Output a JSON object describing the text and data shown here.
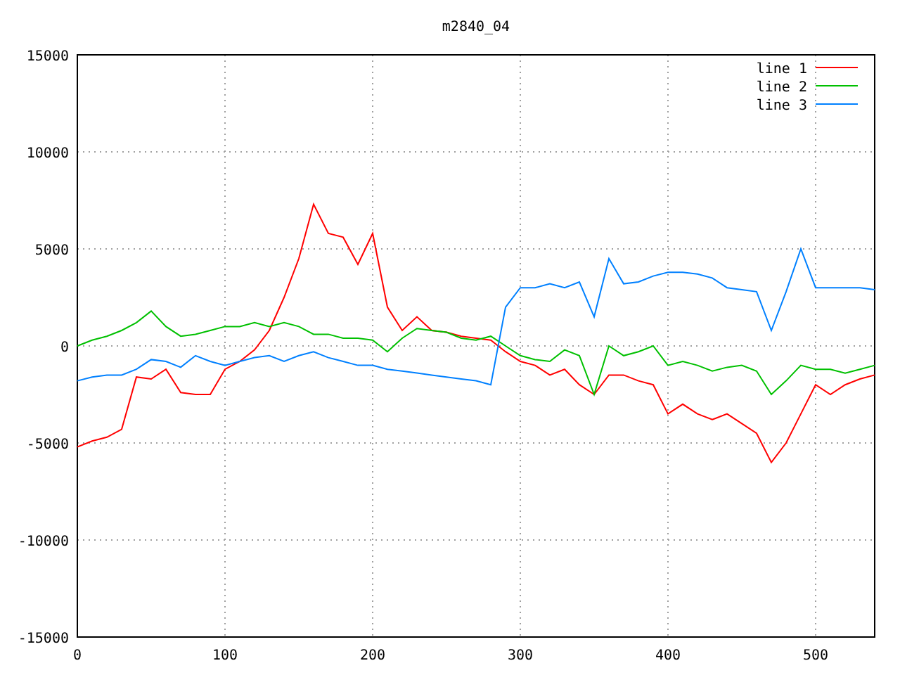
{
  "chart_data": {
    "type": "line",
    "title": "m2840_04",
    "x": [
      0,
      10,
      20,
      30,
      40,
      50,
      60,
      70,
      80,
      90,
      100,
      110,
      120,
      130,
      140,
      150,
      160,
      170,
      180,
      190,
      200,
      210,
      220,
      230,
      240,
      250,
      260,
      270,
      280,
      290,
      300,
      310,
      320,
      330,
      340,
      350,
      360,
      370,
      380,
      390,
      400,
      410,
      420,
      430,
      440,
      450,
      460,
      470,
      480,
      490,
      500,
      510,
      520,
      530,
      540
    ],
    "series": [
      {
        "name": "line 1",
        "color": "#ff0000",
        "values": [
          -5200,
          -4900,
          -4700,
          -4300,
          -1600,
          -1700,
          -1200,
          -2400,
          -2500,
          -2500,
          -1200,
          -800,
          -200,
          800,
          2500,
          4500,
          7300,
          5800,
          5600,
          4200,
          5800,
          2000,
          800,
          1500,
          800,
          700,
          500,
          400,
          300,
          -300,
          -800,
          -1000,
          -1500,
          -1200,
          -2000,
          -2500,
          -1500,
          -1500,
          -1800,
          -2000,
          -3500,
          -3000,
          -3500,
          -3800,
          -3500,
          -4000,
          -4500,
          -6000,
          -5000,
          -3500,
          -2000,
          -2500,
          -2000,
          -1700,
          -1500
        ]
      },
      {
        "name": "line 2",
        "color": "#00c000",
        "values": [
          0,
          300,
          500,
          800,
          1200,
          1800,
          1000,
          500,
          600,
          800,
          1000,
          1000,
          1200,
          1000,
          1200,
          1000,
          600,
          600,
          400,
          400,
          300,
          -300,
          400,
          900,
          800,
          700,
          400,
          300,
          500,
          0,
          -500,
          -700,
          -800,
          -200,
          -500,
          -2500,
          0,
          -500,
          -300,
          0,
          -1000,
          -800,
          -1000,
          -1300,
          -1100,
          -1000,
          -1300,
          -2500,
          -1800,
          -1000,
          -1200,
          -1200,
          -1400,
          -1200,
          -1000
        ]
      },
      {
        "name": "line 3",
        "color": "#0080ff",
        "values": [
          -1800,
          -1600,
          -1500,
          -1500,
          -1200,
          -700,
          -800,
          -1100,
          -500,
          -800,
          -1000,
          -800,
          -600,
          -500,
          -800,
          -500,
          -300,
          -600,
          -800,
          -1000,
          -1000,
          -1200,
          -1300,
          -1400,
          -1500,
          -1600,
          -1700,
          -1800,
          -2000,
          2000,
          3000,
          3000,
          3200,
          3000,
          3300,
          1500,
          4500,
          3200,
          3300,
          3600,
          3800,
          3800,
          3700,
          3500,
          3000,
          2900,
          2800,
          800,
          2800,
          5000,
          3000,
          3000,
          3000,
          3000,
          2900
        ]
      }
    ],
    "xlim": [
      0,
      540
    ],
    "ylim": [
      -15000,
      15000
    ],
    "xticks": [
      0,
      100,
      200,
      300,
      400,
      500
    ],
    "yticks": [
      -15000,
      -10000,
      -5000,
      0,
      5000,
      10000,
      15000
    ],
    "grid": true,
    "legend": true
  }
}
